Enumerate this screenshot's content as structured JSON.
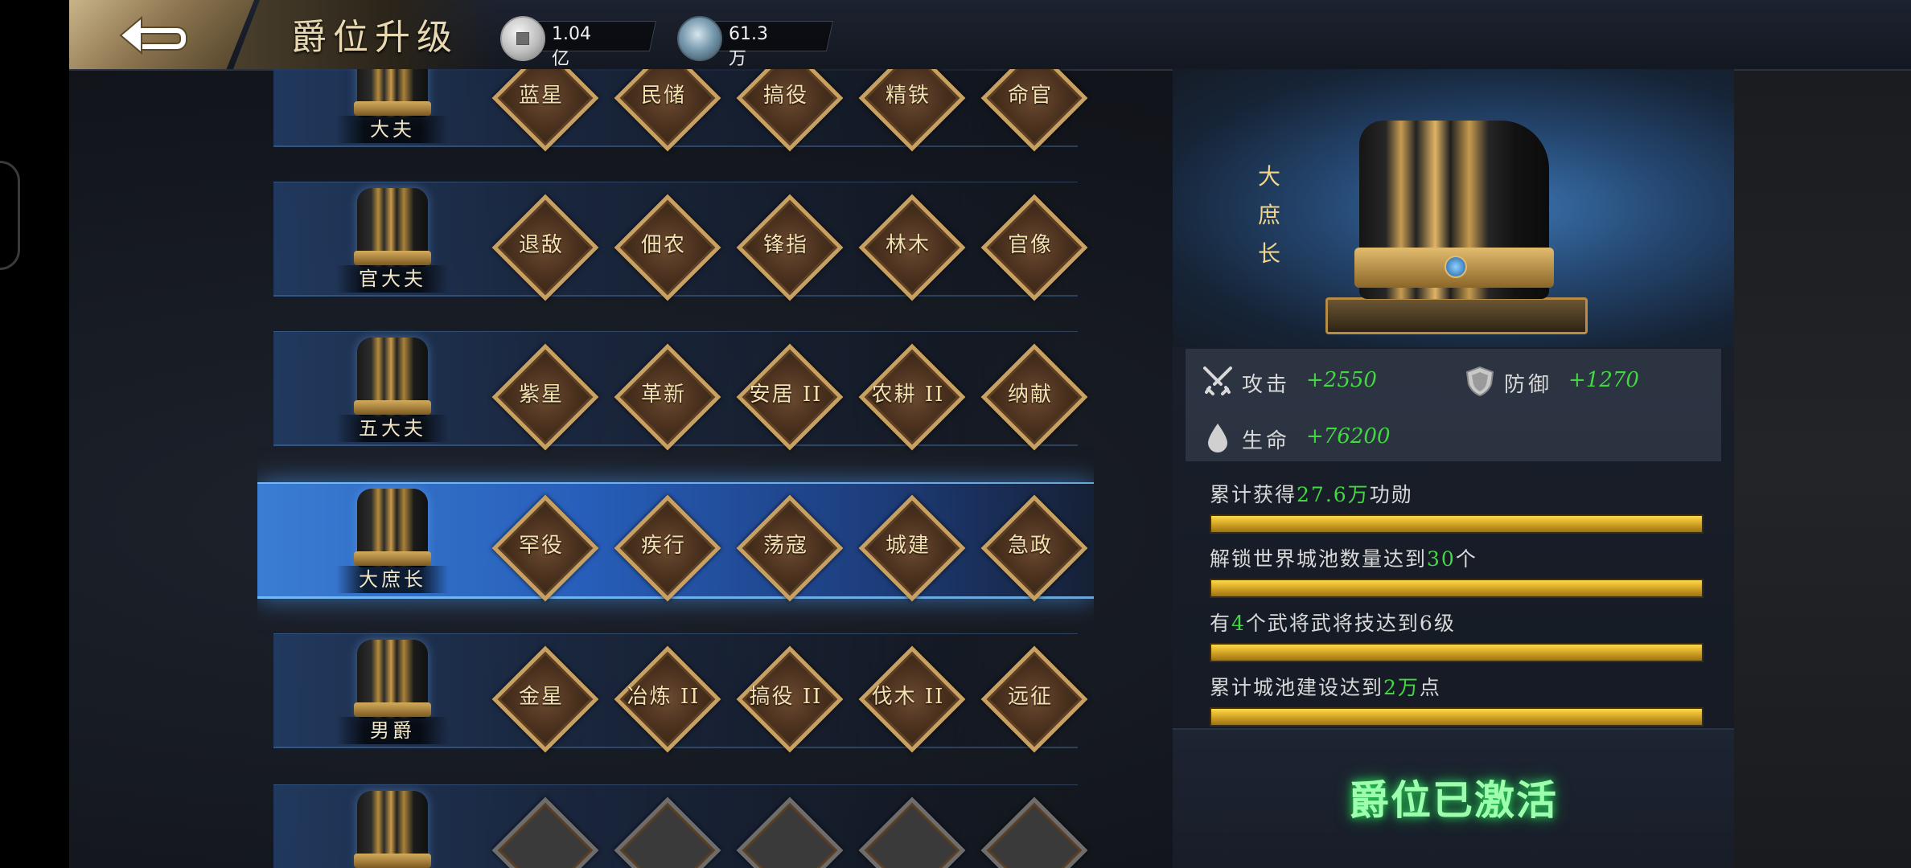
{
  "header": {
    "title": "爵位升级",
    "silver": "1.04亿",
    "merit": "61.3万"
  },
  "ranks": [
    {
      "name": "大夫",
      "skills": [
        "蓝星",
        "民储",
        "搞役",
        "精铁",
        "命官"
      ]
    },
    {
      "name": "官大夫",
      "skills": [
        "退敌",
        "佃农",
        "锋指",
        "林木",
        "官像"
      ]
    },
    {
      "name": "五大夫",
      "skills": [
        "紫星",
        "革新",
        "安居 II",
        "农耕 II",
        "纳献"
      ]
    },
    {
      "name": "大庶长",
      "skills": [
        "罕役",
        "疾行",
        "荡寇",
        "城建",
        "急政"
      ]
    },
    {
      "name": "男爵",
      "skills": [
        "金星",
        "冶炼 II",
        "搞役 II",
        "伐木 II",
        "远征"
      ]
    },
    {
      "name": "",
      "skills": [
        "",
        "",
        "",
        "",
        ""
      ]
    }
  ],
  "selected": {
    "name": "大庶长",
    "attack_label": "攻击",
    "attack_value": "+2550",
    "defense_label": "防御",
    "defense_value": "+1270",
    "hp_label": "生命",
    "hp_value": "+76200",
    "requirements": [
      {
        "pre": "累计获得",
        "hl": "27.6万",
        "post": "功勋"
      },
      {
        "pre": "解锁世界城池数量达到",
        "hl": "30",
        "post": "个"
      },
      {
        "pre": "有",
        "hl": "4",
        "post": "个武将武将技达到6级"
      },
      {
        "pre": "累计城池建设达到",
        "hl": "2万",
        "post": "点"
      }
    ],
    "status": "爵位已激活"
  },
  "colors": {
    "accent_green": "#43d843",
    "gold": "#c8a062",
    "active_blue": "#3c82dc"
  }
}
